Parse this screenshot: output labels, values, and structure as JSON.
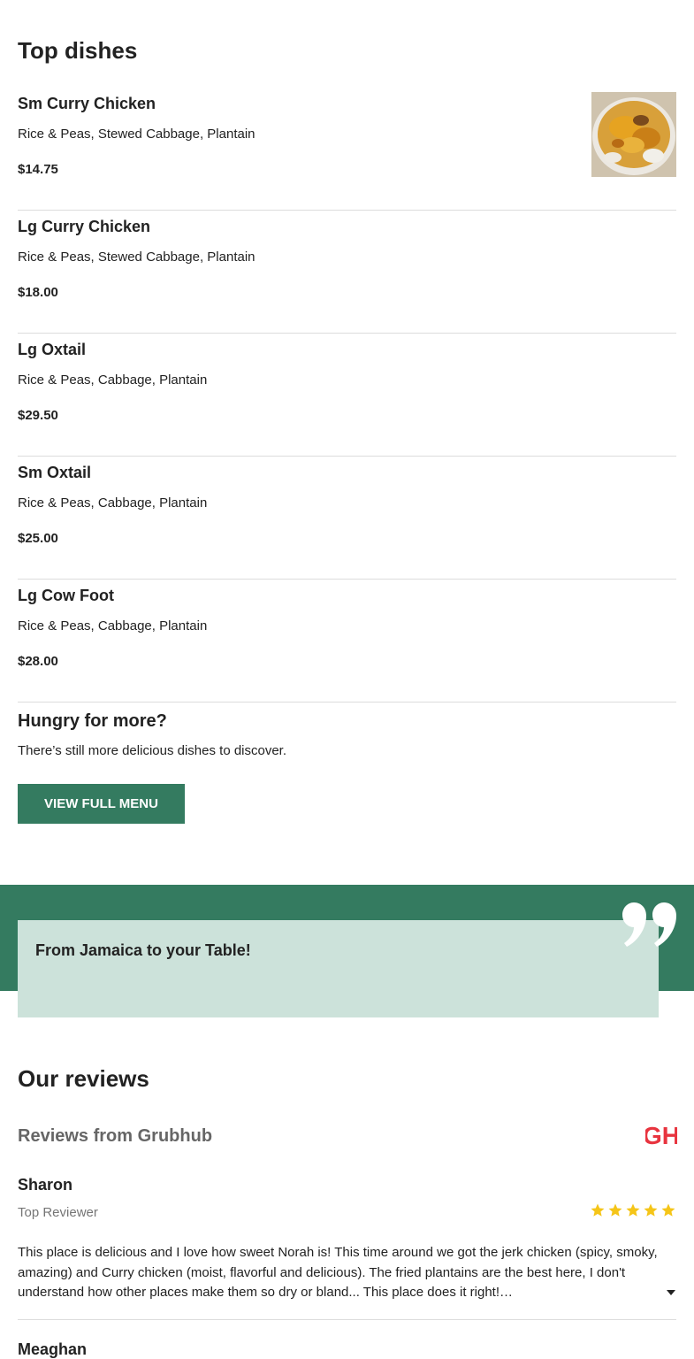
{
  "top_dishes": {
    "title": "Top dishes",
    "items": [
      {
        "name": "Sm Curry Chicken",
        "description": "Rice & Peas, Stewed Cabbage, Plantain",
        "price": "$14.75",
        "has_image": true
      },
      {
        "name": "Lg Curry Chicken",
        "description": "Rice & Peas, Stewed Cabbage, Plantain",
        "price": "$18.00"
      },
      {
        "name": "Lg Oxtail",
        "description": "Rice & Peas, Cabbage, Plantain",
        "price": "$29.50"
      },
      {
        "name": "Sm Oxtail",
        "description": "Rice & Peas, Cabbage, Plantain",
        "price": "$25.00"
      },
      {
        "name": "Lg Cow Foot",
        "description": "Rice & Peas, Cabbage, Plantain",
        "price": "$28.00"
      }
    ]
  },
  "hungry": {
    "title": "Hungry for more?",
    "subtitle": "There’s still more delicious dishes to discover.",
    "button_label": "VIEW FULL MENU"
  },
  "quote": {
    "text": "From Jamaica to your Table!"
  },
  "reviews": {
    "title": "Our reviews",
    "source_title": "Reviews from Grubhub",
    "source_logo_text": "GH",
    "items": [
      {
        "name": "Sharon",
        "badge": "Top Reviewer",
        "rating": 5,
        "text": "This place is delicious and I love how sweet Norah is! This time around we got the jerk chicken (spicy, smoky, amazing) and Curry chicken (moist, flavorful and delicious). The fried plantains are the best here, I don't understand how other places make them so dry or bland... This place does it right!…"
      },
      {
        "name": "Meaghan"
      }
    ]
  },
  "colors": {
    "brand_green": "#347b60",
    "quote_box": "#cce2da",
    "star_yellow": "#f5c518",
    "grubhub_red": "#e8343f"
  }
}
